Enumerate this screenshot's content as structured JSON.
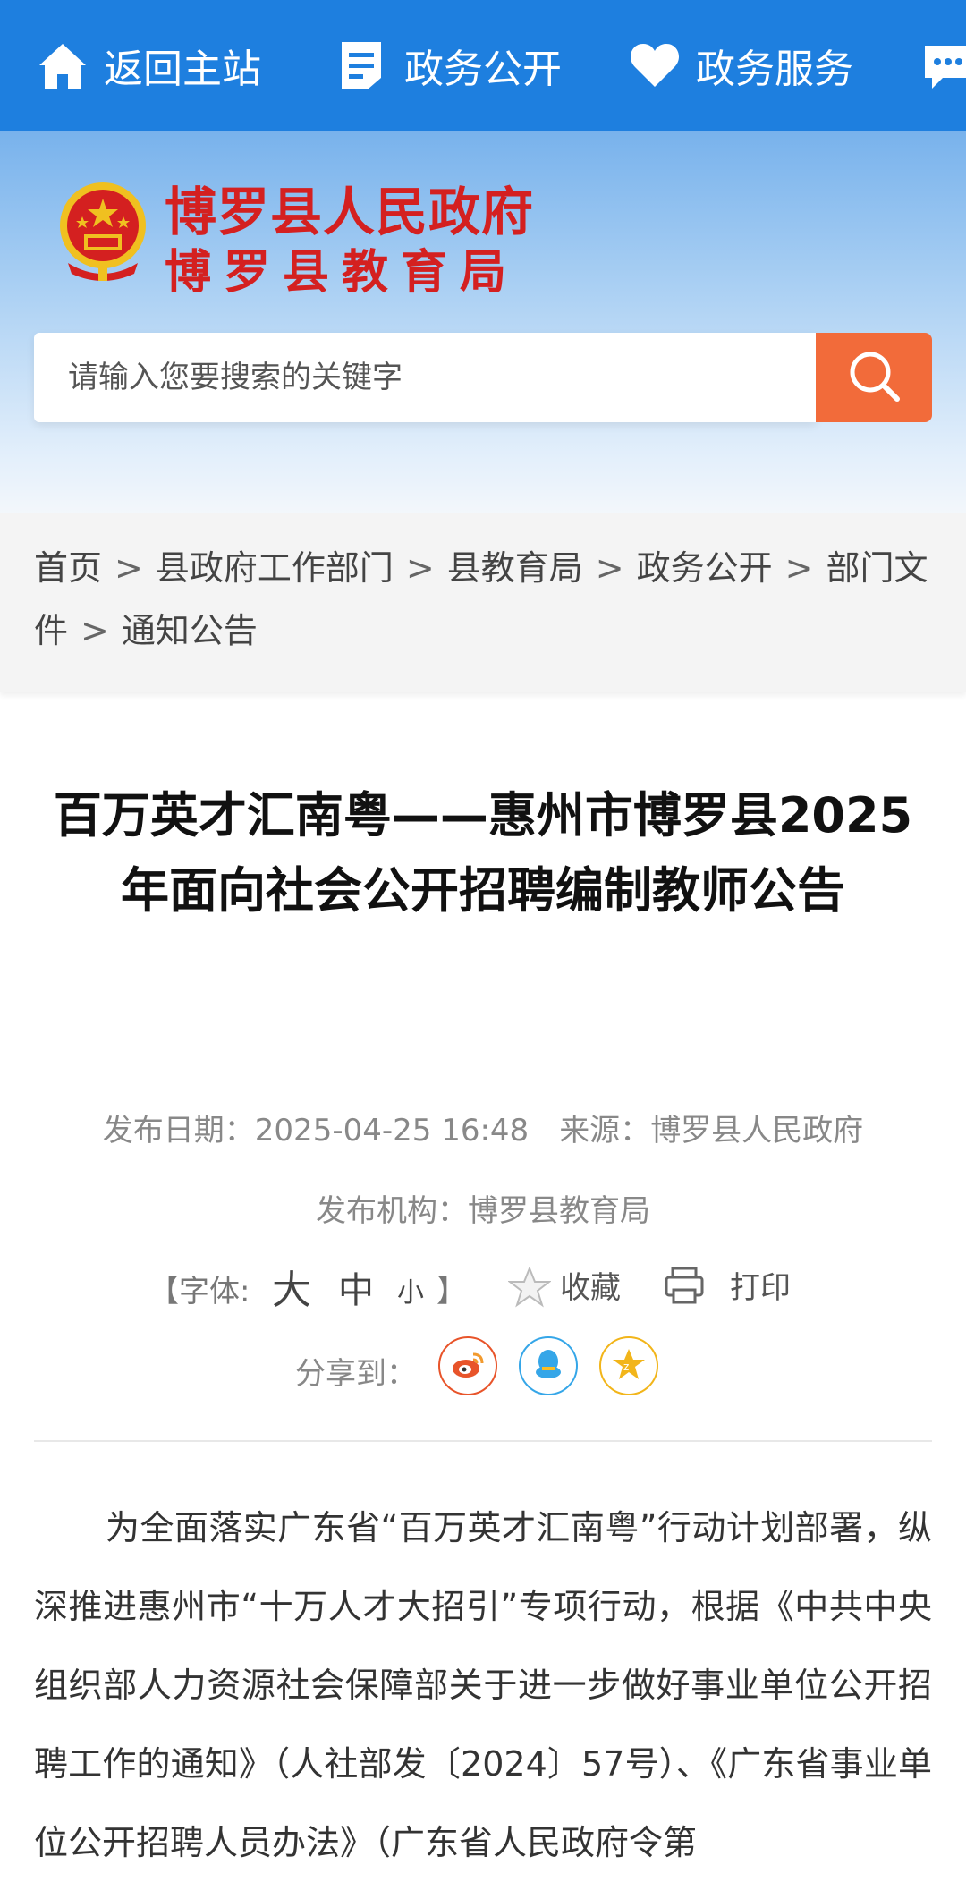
{
  "nav": {
    "items": [
      {
        "label": "返回主站",
        "icon": "home-icon"
      },
      {
        "label": "政务公开",
        "icon": "document-icon"
      },
      {
        "label": "政务服务",
        "icon": "heart-icon"
      },
      {
        "label": "",
        "icon": "chat-icon"
      }
    ]
  },
  "header": {
    "title_line1": "博罗县人民政府",
    "title_line2": "博罗县教育局",
    "emblem": "national-emblem"
  },
  "search": {
    "placeholder": "请输入您要搜索的关键字",
    "value": ""
  },
  "breadcrumb": [
    "首页",
    "县政府工作部门",
    "县教育局",
    "政务公开",
    "部门文件",
    "通知公告"
  ],
  "article": {
    "title": "百万英才汇南粤——惠州市博罗县2025年面向社会公开招聘编制教师公告",
    "date_label": "发布日期：",
    "date": "2025-04-25 16:48",
    "source_label": "来源：",
    "source": "博罗县人民政府",
    "org_label": "发布机构：",
    "org": "博罗县教育局",
    "font_label": "【字体:",
    "font_large": "大",
    "font_medium": "中",
    "font_small": "小",
    "font_close": "】",
    "favorite": "收藏",
    "print": "打印",
    "share_label": "分享到：",
    "share": [
      {
        "name": "weibo",
        "color": "#e8542a"
      },
      {
        "name": "qq",
        "color": "#35a6e8"
      },
      {
        "name": "qzone",
        "color": "#f2b51a"
      }
    ],
    "body": "为全面落实广东省“百万英才汇南粤”行动计划部署，纵深推进惠州市“十万人才大招引”专项行动，根据《中共中央组织部人力资源社会保障部关于进一步做好事业单位公开招聘工作的通知》（人社部发〔2024〕57号）、《广东省事业单位公开招聘人员办法》（广东省人民政府令第"
  },
  "colors": {
    "nav_bg": "#1e7fdf",
    "title_red": "#d42020",
    "search_button": "#f26b3a"
  }
}
